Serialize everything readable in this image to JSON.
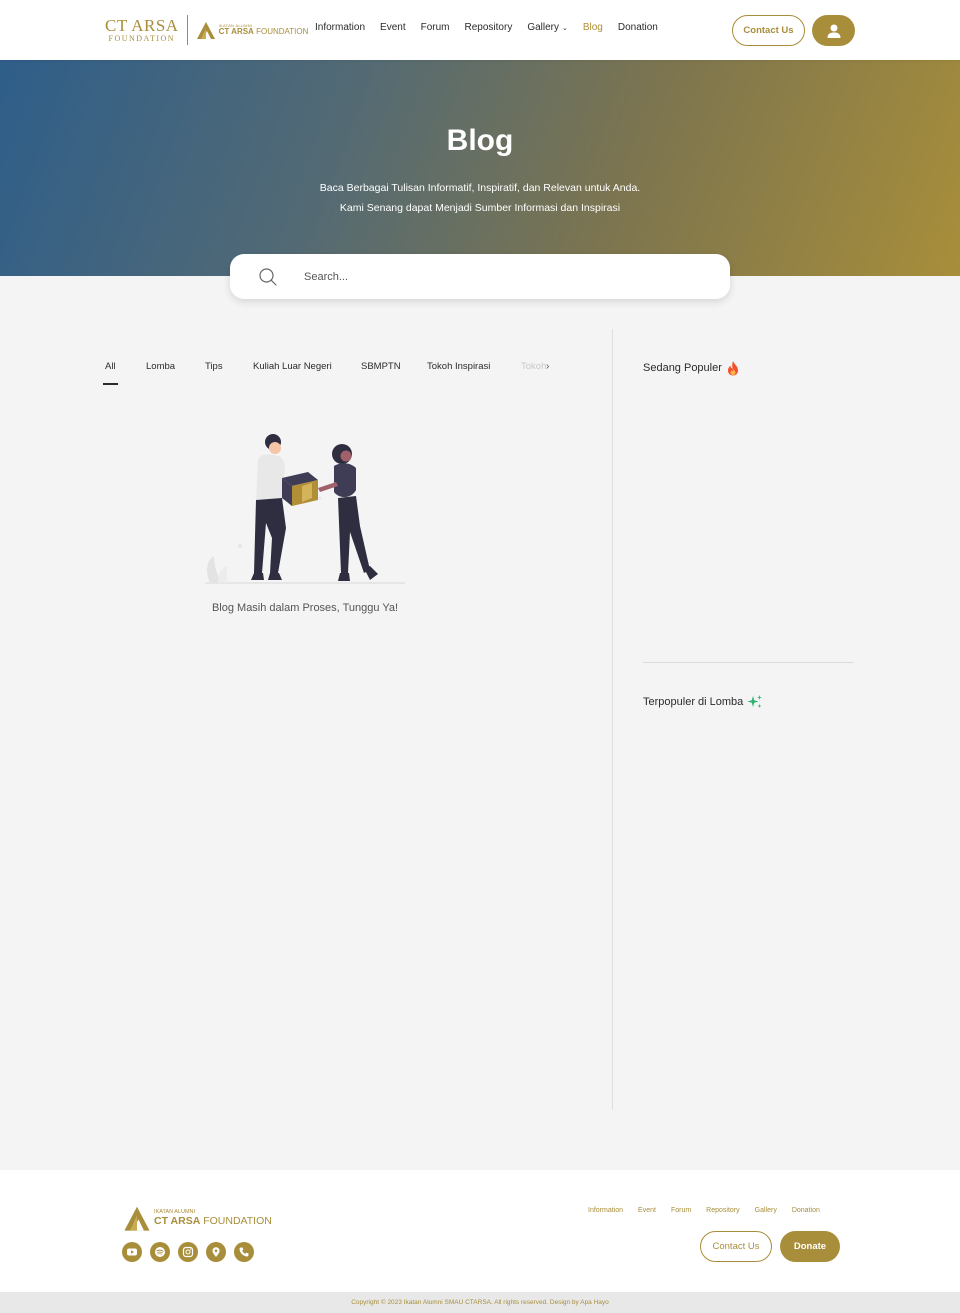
{
  "header": {
    "logo_primary": "CT ARSA",
    "logo_primary_sub": "FOUNDATION",
    "logo_secondary_top": "IKATAN ALUMNI",
    "logo_secondary_bold": "CT ARSA",
    "logo_secondary_rest": "FOUNDATION",
    "nav": {
      "information": "Information",
      "event": "Event",
      "forum": "Forum",
      "repository": "Repository",
      "gallery": "Gallery",
      "blog": "Blog",
      "donation": "Donation"
    },
    "contact_label": "Contact Us",
    "user_icon": "user-icon"
  },
  "hero": {
    "title": "Blog",
    "subtitle_line1": "Baca Berbagai Tulisan Informatif, Inspiratif, dan Relevan untuk Anda.",
    "subtitle_line2": "Kami Senang dapat Menjadi Sumber Informasi dan Inspirasi"
  },
  "search": {
    "placeholder": "Search...",
    "value": ""
  },
  "tabs": {
    "all": "All",
    "lomba": "Lomba",
    "tips": "Tips",
    "kuliah": "Kuliah Luar Negeri",
    "sbmptn": "SBMPTN",
    "tokoh": "Tokoh Inspirasi",
    "faded": "Tokoh",
    "next": "›"
  },
  "main": {
    "empty_message": "Blog Masih dalam Proses, Tunggu Ya!"
  },
  "sidebar": {
    "popular_title": "Sedang Populer",
    "popular_icon": "fire-icon",
    "category_title": "Terpopuler di Lomba",
    "category_icon": "sparkle-icon"
  },
  "footer": {
    "logo_top": "IKATAN ALUMNI",
    "logo_bold": "CT ARSA",
    "logo_rest": "FOUNDATION",
    "nav": {
      "information": "Information",
      "event": "Event",
      "forum": "Forum",
      "repository": "Repository",
      "gallery": "Gallery",
      "donation": "Donation"
    },
    "contact_label": "Contact Us",
    "donate_label": "Donate",
    "socials": [
      "youtube-icon",
      "spotify-icon",
      "instagram-icon",
      "location-icon",
      "phone-icon"
    ],
    "copyright": "Copyright © 2023 Ikatan Alumni SMAU CTARSA. All rights reserved. Design by Apa Hayo"
  },
  "colors": {
    "brand_gold": "#a88e3a",
    "hero_blue": "#2e5e8a",
    "page_bg": "#f4f4f4"
  }
}
